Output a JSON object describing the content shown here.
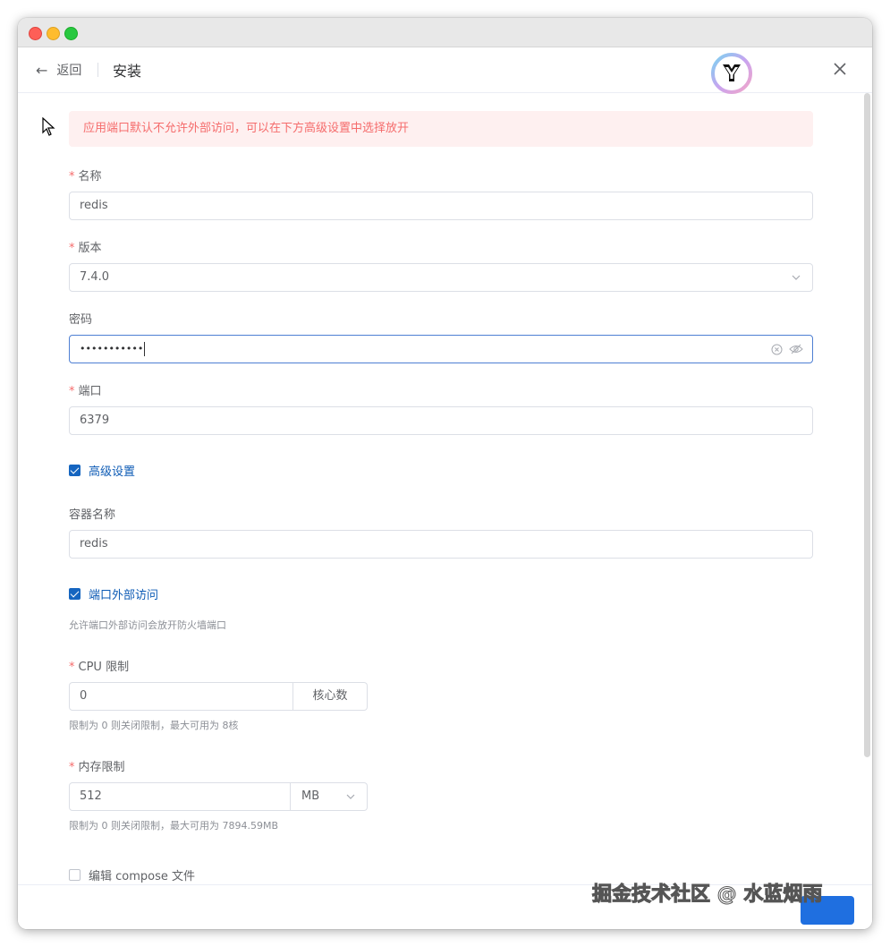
{
  "header": {
    "back_label": "返回",
    "title": "安装"
  },
  "alert": {
    "text": "应用端口默认不允许外部访问，可以在下方高级设置中选择放开"
  },
  "form": {
    "required_mark": "*",
    "name": {
      "label": "名称",
      "value": "redis"
    },
    "version": {
      "label": "版本",
      "value": "7.4.0"
    },
    "password": {
      "label": "密码",
      "value": "•••••••••••"
    },
    "port": {
      "label": "端口",
      "value": "6379"
    },
    "advanced": {
      "label": "高级设置",
      "checked": true
    },
    "container_name": {
      "label": "容器名称",
      "value": "redis"
    },
    "port_external": {
      "label": "端口外部访问",
      "checked": true,
      "help": "允许端口外部访问会放开防火墙端口"
    },
    "cpu_limit": {
      "label": "CPU 限制",
      "value": "0",
      "unit": "核心数",
      "help": "限制为 0 则关闭限制，最大可用为 8核"
    },
    "memory_limit": {
      "label": "内存限制",
      "value": "512",
      "unit": "MB",
      "help": "限制为 0 则关闭限制，最大可用为 7894.59MB"
    },
    "edit_compose": {
      "label": "编辑 compose 文件",
      "checked": false
    }
  },
  "footer": {
    "watermark": "掘金技术社区 @ 水蓝烟雨"
  },
  "colors": {
    "primary": "#1f6fe0",
    "danger": "#f56c6c",
    "alert_bg": "#fef0f0",
    "link": "#0d5bb5"
  }
}
